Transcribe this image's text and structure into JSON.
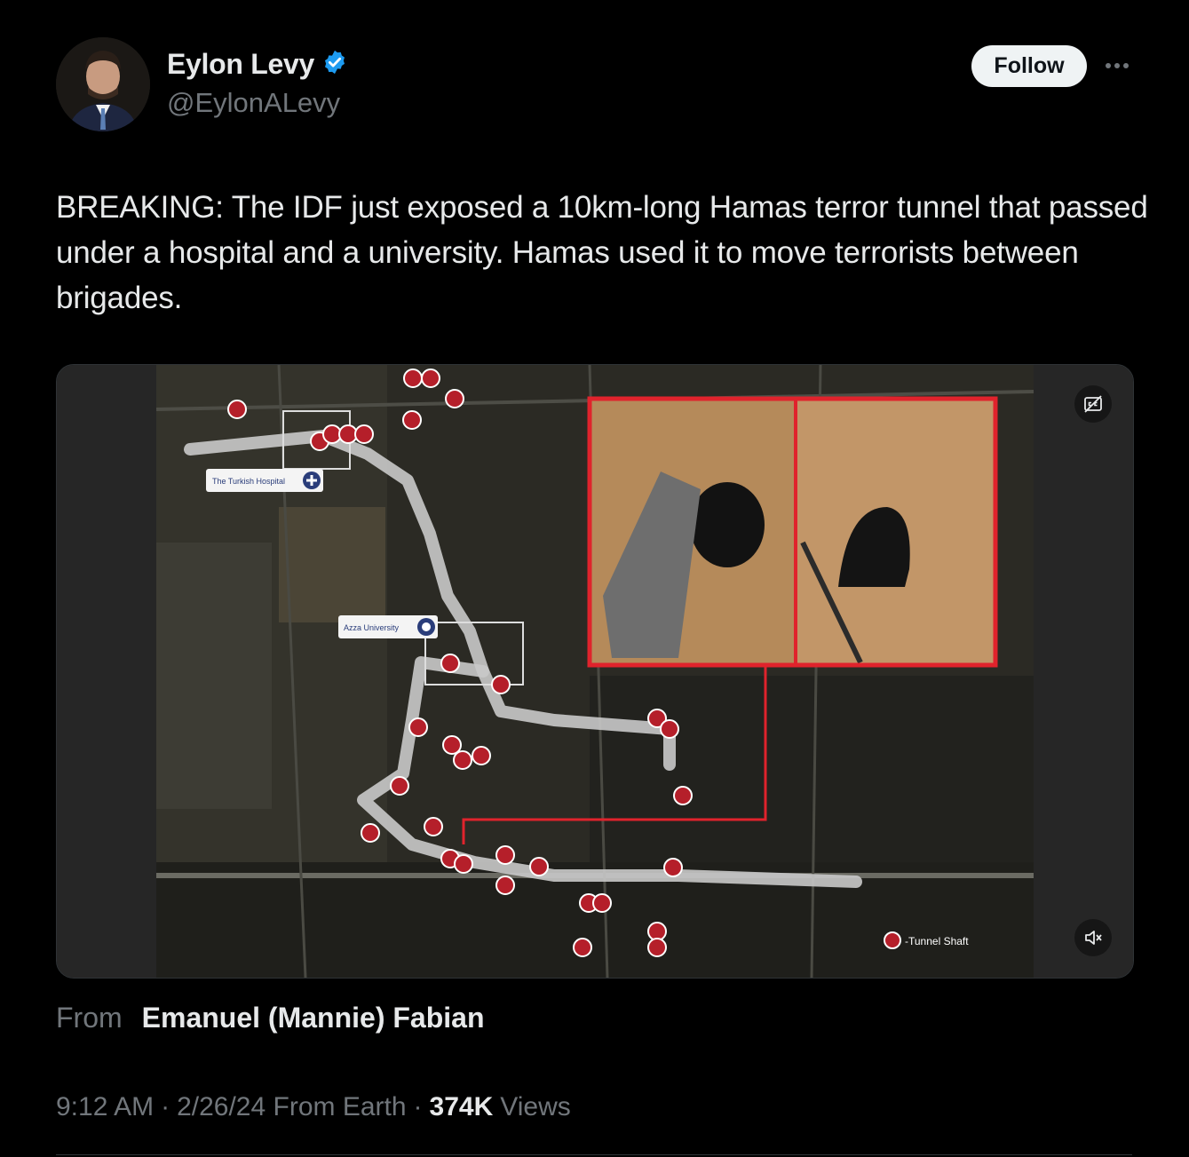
{
  "author": {
    "display_name": "Eylon Levy",
    "handle": "@EylonALevy",
    "verified_icon": "verified-badge-icon"
  },
  "follow_label": "Follow",
  "more_icon": "more-icon",
  "tweet_text": "BREAKING: The IDF just exposed a 10km-long Hamas terror tunnel that passed under a hospital and a university. Hamas used it to move terrorists between brigades.",
  "media": {
    "map_labels": {
      "hospital": "The Turkish Hospital",
      "university": "Azza University",
      "legend": "-Tunnel Shaft"
    },
    "captions_icon": "captions-icon",
    "mute_icon": "mute-icon"
  },
  "source": {
    "label": "From",
    "name": "Emanuel (Mannie) Fabian"
  },
  "meta": {
    "time": "9:12 AM",
    "sep1": "·",
    "date_location": "2/26/24 From Earth",
    "sep2": "·",
    "views_count": "374K",
    "views_label": "Views"
  },
  "colors": {
    "background": "#000000",
    "text": "#e7e9ea",
    "muted": "#71767b",
    "verified": "#1d9bf0",
    "tunnel_red": "#e0232c"
  }
}
